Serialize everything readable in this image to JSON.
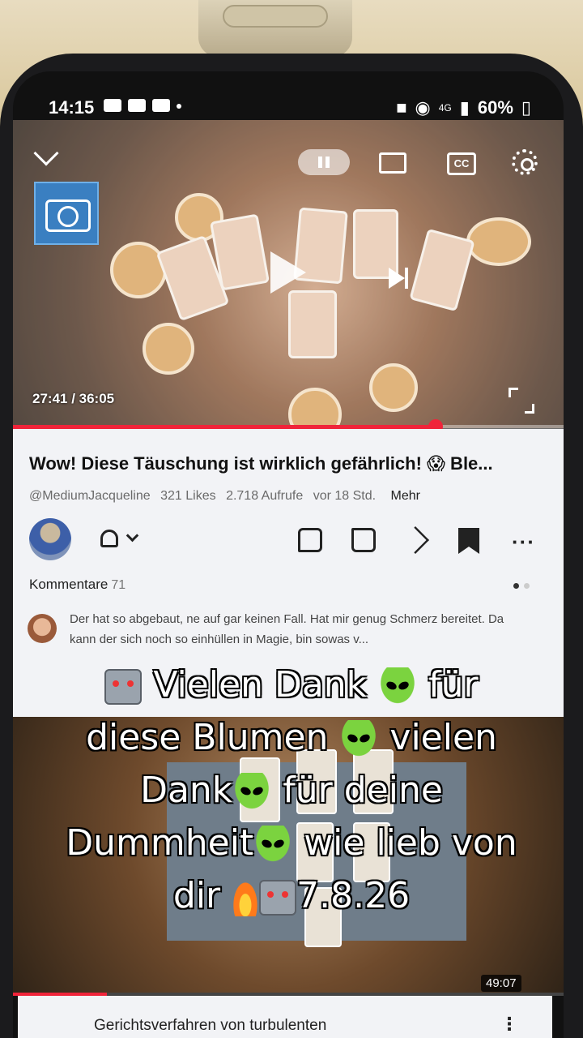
{
  "status_bar": {
    "time": "14:15",
    "network": "4G",
    "battery": "60%"
  },
  "player": {
    "current_time": "27:41",
    "duration": "36:05",
    "time_display": "27:41 / 36:05",
    "progress_fraction": 0.767,
    "cc_label": "CC"
  },
  "video": {
    "title": "Wow! Diese Täuschung ist wirklich gefährlich! 😱 Ble...",
    "channel": "@MediumJacqueline",
    "likes": "321 Likes",
    "views": "2.718 Aufrufe",
    "age": "vor 18 Std.",
    "more_label": "Mehr"
  },
  "comments": {
    "label": "Kommentare",
    "count": "71",
    "top_comment": "Der hat so abgebaut, ne auf gar keinen Fall.  Hat mir genug Schmerz bereitet. Da kann der sich noch so einhüllen in Magie, bin sowas v..."
  },
  "overlay_caption": {
    "line1": "Vielen Dank",
    "line1b": "für",
    "line2": "diese Blumen",
    "line2b": "vielen",
    "line3": "Dank",
    "line3b": "für deine",
    "line4": "Dummheit",
    "line4b": "wie lieb von",
    "line5": "dir",
    "line5b": "7.8.26"
  },
  "next_video": {
    "duration": "49:07",
    "title": "Gerichtsverfahren von turbulenten",
    "progress_fraction": 0.17
  },
  "icons": [
    "chevron-down-icon",
    "pause-icon",
    "cast-icon",
    "cc-icon",
    "gear-icon",
    "camera-icon",
    "play-icon",
    "next-icon",
    "fullscreen-icon",
    "bell-icon",
    "like-icon",
    "dislike-icon",
    "share-icon",
    "save-icon",
    "more-icon"
  ],
  "colors": {
    "accent": "#f0243a",
    "panel": "#f2f3f6"
  }
}
